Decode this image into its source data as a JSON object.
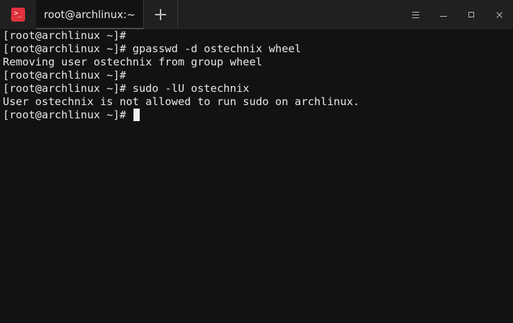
{
  "window": {
    "tab_title": "root@archlinux:~",
    "icon": "terminal-icon",
    "new_tab_icon": "plus-icon",
    "controls": [
      "menu-icon",
      "minimize-icon",
      "maximize-icon",
      "close-icon"
    ]
  },
  "colors": {
    "background": "#121212",
    "titlebar": "#202020",
    "text": "#e8e8e8",
    "icon_accent": "#e0323d"
  },
  "terminal": {
    "lines": [
      {
        "text": "[root@archlinux ~]#"
      },
      {
        "text": "[root@archlinux ~]# gpasswd -d ostechnix wheel"
      },
      {
        "text": "Removing user ostechnix from group wheel"
      },
      {
        "text": "[root@archlinux ~]#"
      },
      {
        "text": "[root@archlinux ~]# sudo -lU ostechnix"
      },
      {
        "text": "User ostechnix is not allowed to run sudo on archlinux."
      },
      {
        "text": "[root@archlinux ~]# "
      }
    ]
  }
}
